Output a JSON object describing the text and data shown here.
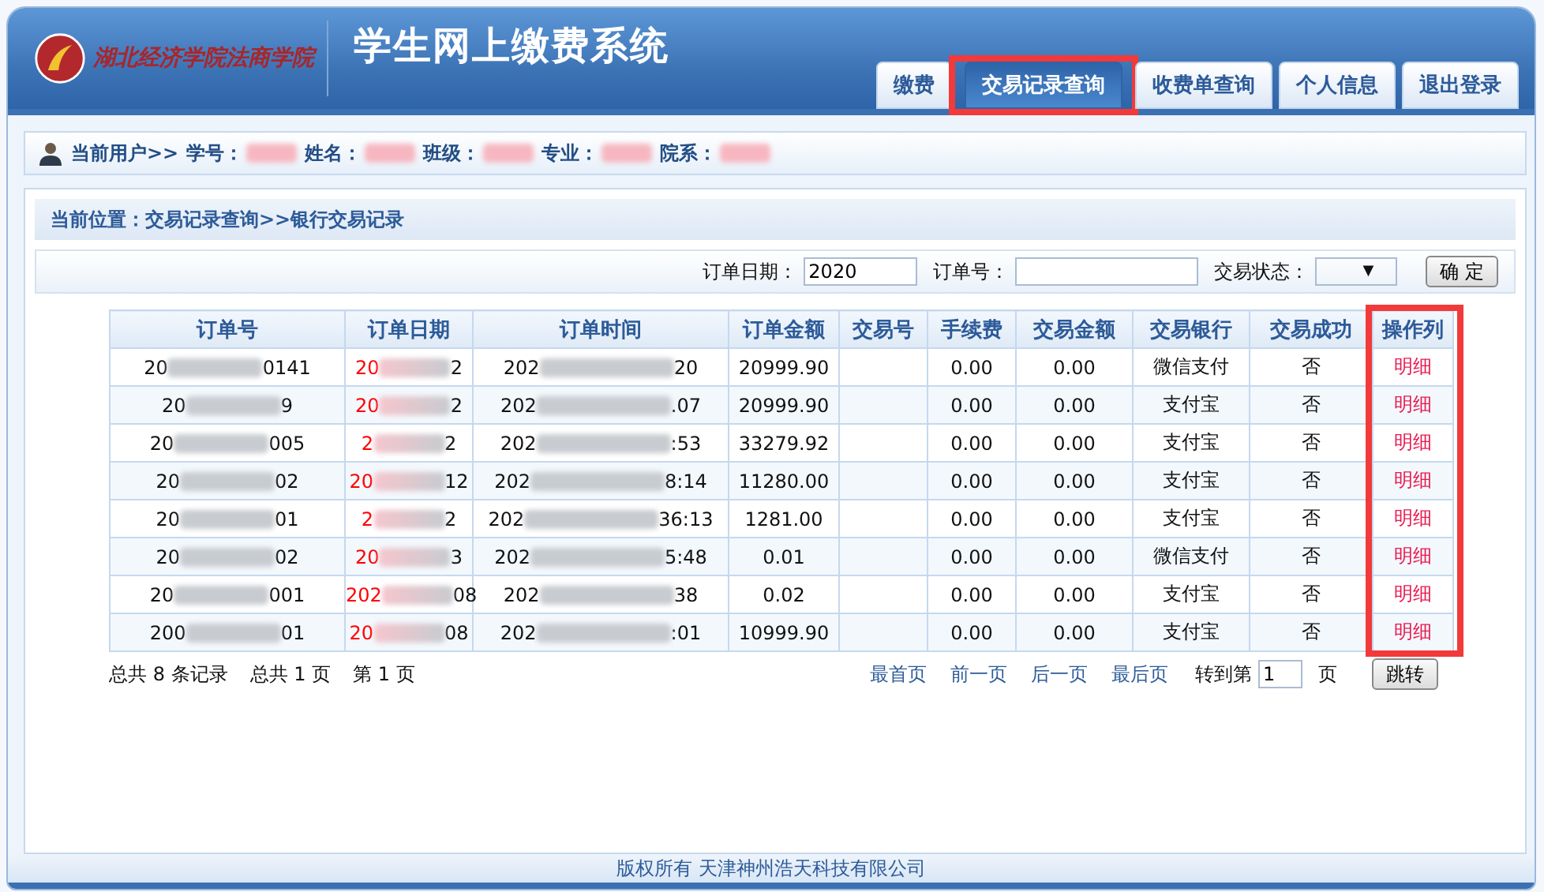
{
  "header": {
    "logo_text": "湖北经济学院法商学院",
    "system_title": "学生网上缴费系统"
  },
  "tabs": [
    {
      "label": "缴费",
      "selected": false,
      "highlighted": false
    },
    {
      "label": "交易记录查询",
      "selected": true,
      "highlighted": true
    },
    {
      "label": "收费单查询",
      "selected": false,
      "highlighted": false
    },
    {
      "label": "个人信息",
      "selected": false,
      "highlighted": false
    },
    {
      "label": "退出登录",
      "selected": false,
      "highlighted": false
    }
  ],
  "user_bar": {
    "prefix": "当前用户>>",
    "fields": [
      "学号：",
      "姓名：",
      "班级：",
      "专业：",
      "院系："
    ]
  },
  "breadcrumb": "当前位置：交易记录查询>>银行交易记录",
  "filters": {
    "date_label": "订单日期：",
    "date_value": "2020",
    "order_label": "订单号：",
    "status_label": "交易状态：",
    "dropdown_arrow": "▼",
    "confirm": "确 定"
  },
  "table": {
    "columns": [
      "订单号",
      "订单日期",
      "订单时间",
      "订单金额",
      "交易号",
      "手续费",
      "交易金额",
      "交易银行",
      "交易成功",
      "操作列"
    ],
    "highlight_last_column": true,
    "rows": [
      {
        "order_no": [
          "20",
          "0141"
        ],
        "order_date": [
          "20",
          "2"
        ],
        "order_time": [
          "202",
          "20"
        ],
        "amount": "20999.90",
        "fee": "0.00",
        "trade_amount": "0.00",
        "bank": "微信支付",
        "success": "否",
        "action": "明细"
      },
      {
        "order_no": [
          "20",
          "9"
        ],
        "order_date": [
          "20",
          "2"
        ],
        "order_time": [
          "202",
          ".07"
        ],
        "amount": "20999.90",
        "fee": "0.00",
        "trade_amount": "0.00",
        "bank": "支付宝",
        "success": "否",
        "action": "明细"
      },
      {
        "order_no": [
          "20",
          "005"
        ],
        "order_date": [
          "2",
          "2"
        ],
        "order_time": [
          "202",
          ":53"
        ],
        "amount": "33279.92",
        "fee": "0.00",
        "trade_amount": "0.00",
        "bank": "支付宝",
        "success": "否",
        "action": "明细"
      },
      {
        "order_no": [
          "20",
          "02"
        ],
        "order_date": [
          "20",
          "12"
        ],
        "order_time": [
          "202",
          "8:14"
        ],
        "amount": "11280.00",
        "fee": "0.00",
        "trade_amount": "0.00",
        "bank": "支付宝",
        "success": "否",
        "action": "明细"
      },
      {
        "order_no": [
          "20",
          "01"
        ],
        "order_date": [
          "2",
          "2"
        ],
        "order_time": [
          "202",
          "36:13"
        ],
        "amount": "1281.00",
        "fee": "0.00",
        "trade_amount": "0.00",
        "bank": "支付宝",
        "success": "否",
        "action": "明细"
      },
      {
        "order_no": [
          "20",
          "02"
        ],
        "order_date": [
          "20",
          "3"
        ],
        "order_time": [
          "202",
          "5:48"
        ],
        "amount": "0.01",
        "fee": "0.00",
        "trade_amount": "0.00",
        "bank": "微信支付",
        "success": "否",
        "action": "明细"
      },
      {
        "order_no": [
          "20",
          "001"
        ],
        "order_date": [
          "202",
          "08"
        ],
        "order_time": [
          "202",
          "38"
        ],
        "amount": "0.02",
        "fee": "0.00",
        "trade_amount": "0.00",
        "bank": "支付宝",
        "success": "否",
        "action": "明细"
      },
      {
        "order_no": [
          "200",
          "01"
        ],
        "order_date": [
          "20",
          "08"
        ],
        "order_time": [
          "202",
          ":01"
        ],
        "amount": "10999.90",
        "fee": "0.00",
        "trade_amount": "0.00",
        "bank": "支付宝",
        "success": "否",
        "action": "明细"
      }
    ]
  },
  "pager": {
    "summary": [
      "总共 8 条记录",
      "总共 1 页",
      "第 1 页"
    ],
    "links": [
      "最首页",
      "前一页",
      "后一页",
      "最后页"
    ],
    "goto_label": "转到第",
    "goto_value": "1",
    "page_unit": "页",
    "jump": "跳转"
  },
  "footer": "版权所有 天津神州浩天科技有限公司"
}
